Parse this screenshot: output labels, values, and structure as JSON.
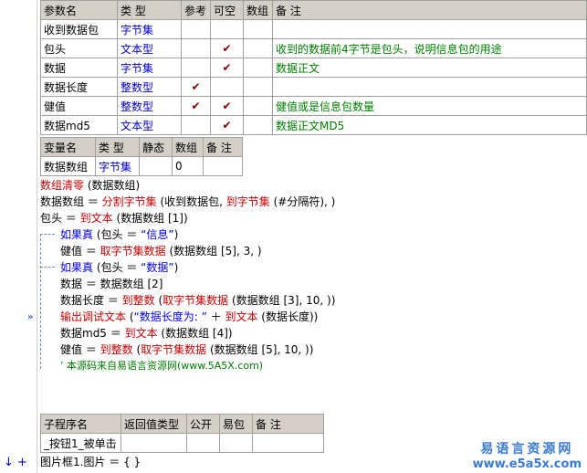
{
  "param_table": {
    "headers": [
      "参数名",
      "类 型",
      "参考",
      "可空",
      "数组",
      "备 注"
    ],
    "rows": [
      {
        "name": "收到数据包",
        "type": "字节集",
        "ref": "",
        "nullable": "",
        "array": "",
        "note": ""
      },
      {
        "name": "包头",
        "type": "文本型",
        "ref": "",
        "nullable": "✔",
        "array": "",
        "note": "收到的数据前4字节是包头，说明信息包的用途"
      },
      {
        "name": "数据",
        "type": "字节集",
        "ref": "",
        "nullable": "✔",
        "array": "",
        "note": "数据正文"
      },
      {
        "name": "数据长度",
        "type": "整数型",
        "ref": "✔",
        "nullable": "",
        "array": "",
        "note": ""
      },
      {
        "name": "健值",
        "type": "整数型",
        "ref": "✔",
        "nullable": "✔",
        "array": "",
        "note": "健值或是信息包数量"
      },
      {
        "name": "数据md5",
        "type": "文本型",
        "ref": "",
        "nullable": "✔",
        "array": "",
        "note": "数据正文MD5"
      }
    ]
  },
  "var_table": {
    "headers": [
      "变量名",
      "类 型",
      "静态",
      "数组",
      "备 注"
    ],
    "rows": [
      {
        "name": "数据数组",
        "type": "字节集",
        "static": "",
        "array": "0",
        "note": ""
      }
    ]
  },
  "code": {
    "l1": {
      "a": "数组清零",
      "b": " (数据数组)"
    },
    "l2": {
      "a": "数据数组 ＝ ",
      "b": "分割字节集",
      "c": " (收到数据包, ",
      "d": "到字节集",
      "e": " (#分隔符), )"
    },
    "l3": {
      "a": "包头 ＝ ",
      "b": "到文本",
      "c": " (数据数组 [1])"
    },
    "l4": {
      "a": "如果真",
      "b": " (包头 ＝ ",
      "c": "“信息”",
      "d": ")"
    },
    "l5": {
      "a": "健值 ＝ ",
      "b": "取字节集数据",
      "c": " (数据数组 [5], 3, )"
    },
    "l6": {
      "a": "如果真",
      "b": " (包头 ＝ ",
      "c": "“数据”",
      "d": ")"
    },
    "l7": {
      "a": "数据 ＝ 数据数组 [2]"
    },
    "l8": {
      "a": "数据长度 ＝ ",
      "b": "到整数",
      "c": " (",
      "d": "取字节集数据",
      "e": " (数据数组 [3], 10, ))"
    },
    "l9": {
      "a": "输出调试文本",
      "b": " (",
      "c": "“数据长度为: ”",
      "d": " ＋ ",
      "e": "到文本",
      "f": " (数据长度))"
    },
    "l10": {
      "a": "数据md5 ＝ ",
      "b": "到文本",
      "c": " (数据数组 [4])"
    },
    "l11": {
      "a": "健值 ＝ ",
      "b": "到整数",
      "c": " (",
      "d": "取字节集数据",
      "e": " (数据数组 [5], 10, ))"
    },
    "l12": {
      "a": "’ 本源码来自易语言资源网(www.5A5X.com)"
    }
  },
  "sub_table": {
    "headers": [
      "子程序名",
      "返回值类型",
      "公开",
      "易包",
      "备 注"
    ],
    "rows": [
      {
        "name": "_按钮1_被单击",
        "ret": "",
        "public": "",
        "pkg": "",
        "note": ""
      }
    ]
  },
  "last_line": {
    "a": "图片框1.图片 ＝ { }"
  },
  "markers": {
    "arrow": "»",
    "bottom_left": "↓ +"
  },
  "watermark": {
    "line1": "易语言资源网",
    "line2": "www.e5a5x.com"
  },
  "colors": {
    "keyword_blue": "#0000ff",
    "keyword_red": "#cc0000",
    "type_blue": "#0000cc",
    "note_green": "#008000",
    "header_bg": "#d4d0c8"
  }
}
